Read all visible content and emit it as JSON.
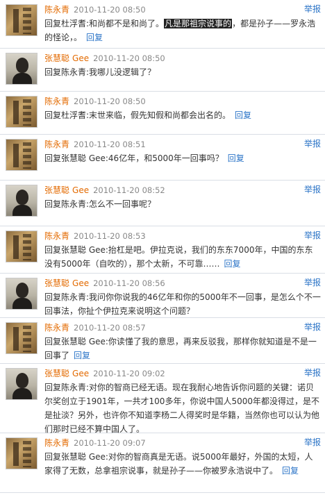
{
  "comments": [
    {
      "author": "陈永青",
      "author_suffix": "",
      "avatar": "book-avatar",
      "time": "2010-11-20 08:50",
      "report": "举报",
      "text_before": "回复杜浮耆:和尚都不是和尚了。",
      "text_highlight": "凡是那祖宗说事的",
      "text_after": "，都是孙子——罗永浩的怪论，。",
      "reply": "回复"
    },
    {
      "author": "张慧聪",
      "author_suffix": "Gee",
      "avatar": "person-avatar",
      "time": "2010-11-20 08:50",
      "report": "",
      "text": "回复陈永青:我哪儿没逻辑了？",
      "reply": ""
    },
    {
      "author": "陈永青",
      "author_suffix": "",
      "avatar": "book-avatar",
      "time": "2010-11-20 08:50",
      "report": "",
      "text": "回复杜浮耆:末世来临，假先知假和尚都会出名的。",
      "reply": "回复"
    },
    {
      "author": "陈永青",
      "author_suffix": "",
      "avatar": "book-avatar",
      "time": "2010-11-20 08:51",
      "report": "举报",
      "text": "回复张慧聪 Gee:46亿年，和5000年一回事吗？",
      "reply": "回复"
    },
    {
      "author": "张慧聪",
      "author_suffix": "Gee",
      "avatar": "person-avatar",
      "time": "2010-11-20 08:52",
      "report": "举报",
      "text": "回复陈永青:怎么不一回事呢？",
      "reply": ""
    },
    {
      "author": "陈永青",
      "author_suffix": "",
      "avatar": "book-avatar",
      "time": "2010-11-20 08:53",
      "report": "举报",
      "text": "回复张慧聪 Gee:抬杠是吧。伊拉克说，我们的东东7000年，中国的东东没有5000年（自吹的），那个太新，不可靠……",
      "reply": "回复"
    },
    {
      "author": "张慧聪",
      "author_suffix": "Gee",
      "avatar": "person-avatar",
      "time": "2010-11-20 08:56",
      "report": "举报",
      "text": "回复陈永青:我问你你说我的46亿年和你的5000年不一回事，是怎么个不一回事法，你扯个伊拉克来说明这个问题？",
      "reply": ""
    },
    {
      "author": "陈永青",
      "author_suffix": "",
      "avatar": "book-avatar",
      "time": "2010-11-20 08:57",
      "report": "举报",
      "text": "回复张慧聪 Gee:你读懂了我的意思，再来反驳我，那样你就知道是不是一回事了",
      "reply": "回复"
    },
    {
      "author": "张慧聪",
      "author_suffix": "Gee",
      "avatar": "person-avatar",
      "time": "2010-11-20 09:02",
      "report": "举报",
      "text": "回复陈永青:对你的智商已经无语。现在我耐心地告诉你问题的关键：诺贝尔奖创立于1901年，一共才100多年，你说中国人5000年都没得过，是不是扯淡？另外，也许你不知道李杨二人得奖时是华籍，当然你也可以认为他们那时已经不算中国人了。",
      "reply": ""
    },
    {
      "author": "陈永青",
      "author_suffix": "",
      "avatar": "book-avatar",
      "time": "2010-11-20 09:07",
      "report": "举报",
      "text": "回复张慧聪 Gee:对你的智商真是无语。说5000年最好，外国的太短，人家得了无数，总拿祖宗说事，就是孙子——你被罗永浩说中了。",
      "reply": "回复"
    }
  ]
}
